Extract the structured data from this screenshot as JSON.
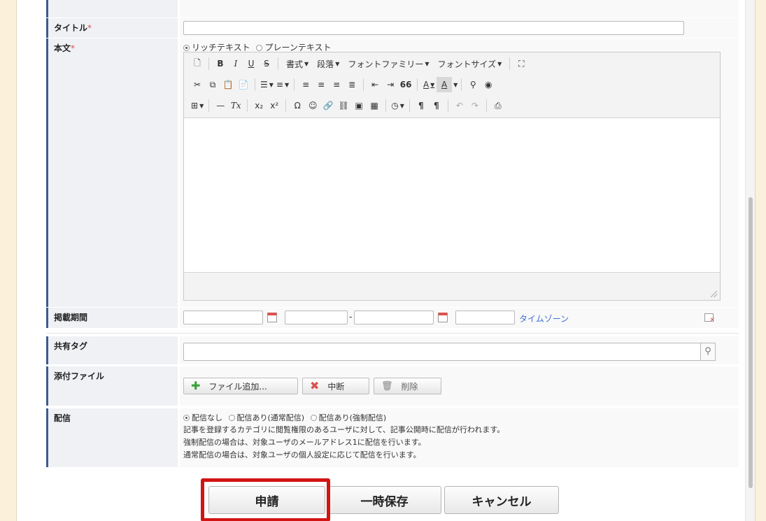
{
  "form": {
    "title": {
      "label": "タイトル",
      "required_mark": "*",
      "value": ""
    },
    "body": {
      "label": "本文",
      "required_mark": "*",
      "format_rich": "リッチテキスト",
      "format_plain": "プレーンテキスト",
      "selected_format": "rich",
      "toolbar": {
        "row1": [
          "new-document",
          "bold",
          "italic",
          "underline",
          "strikethrough",
          "書式",
          "段落",
          "フォントファミリー",
          "フォントサイズ",
          "fullscreen"
        ],
        "bold": "B",
        "italic": "I",
        "underline": "U",
        "strike": "S",
        "format": "書式",
        "paragraph": "段落",
        "font_family": "フォントファミリー",
        "font_size": "フォントサイズ",
        "blockquote": "66",
        "text_color": "A",
        "bg_color": "A",
        "hr": "—",
        "subscript": "x₂",
        "superscript": "x²",
        "omega": "Ω",
        "pilcrow1": "¶",
        "pilcrow2": "¶"
      }
    },
    "period": {
      "label": "掲載期間",
      "start_date": "",
      "start_time": "",
      "end_date": "",
      "end_time": "",
      "separator": "-",
      "timezone_link": "タイムゾーン"
    },
    "tags": {
      "label": "共有タグ",
      "value": ""
    },
    "attachments": {
      "label": "添付ファイル",
      "add_button": "ファイル追加...",
      "cancel_button": "中断",
      "delete_button": "削除"
    },
    "delivery": {
      "label": "配信",
      "options": [
        "配信なし",
        "配信あり(通常配信)",
        "配信あり(強制配信)"
      ],
      "selected": 0,
      "notes": [
        "記事を登録するカテゴリに閲覧権限のあるユーザに対して、記事公開時に配信が行われます。",
        "強制配信の場合は、対象ユーザのメールアドレス1に配信を行います。",
        "通常配信の場合は、対象ユーザの個人設定に応じて配信を行います。"
      ]
    }
  },
  "actions": {
    "submit": "申請",
    "save_draft": "一時保存",
    "cancel": "キャンセル"
  },
  "colors": {
    "page_bg": "#fbf0da",
    "label_accent": "#3d5a8c",
    "highlight": "#d21414",
    "link": "#3f6ed4"
  }
}
